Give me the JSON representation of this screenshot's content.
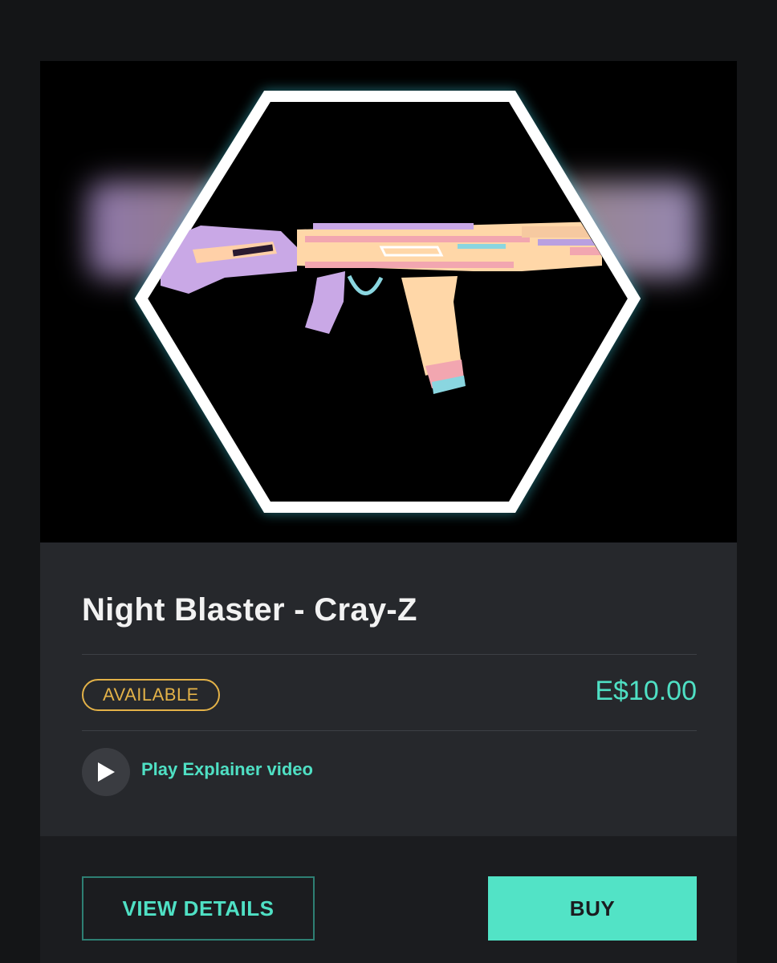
{
  "product": {
    "title": "Night Blaster - Cray-Z",
    "status": "AVAILABLE",
    "price": "E$10.00",
    "video_label": "Play Explainer video"
  },
  "actions": {
    "view_details_label": "VIEW DETAILS",
    "buy_label": "BUY"
  },
  "colors": {
    "accent": "#4fe0c4",
    "status": "#e3b248",
    "card_bg": "#26282c",
    "page_bg": "#141517",
    "hex_glow": "#3fd6e8"
  },
  "icons": {
    "play": "play-icon"
  }
}
